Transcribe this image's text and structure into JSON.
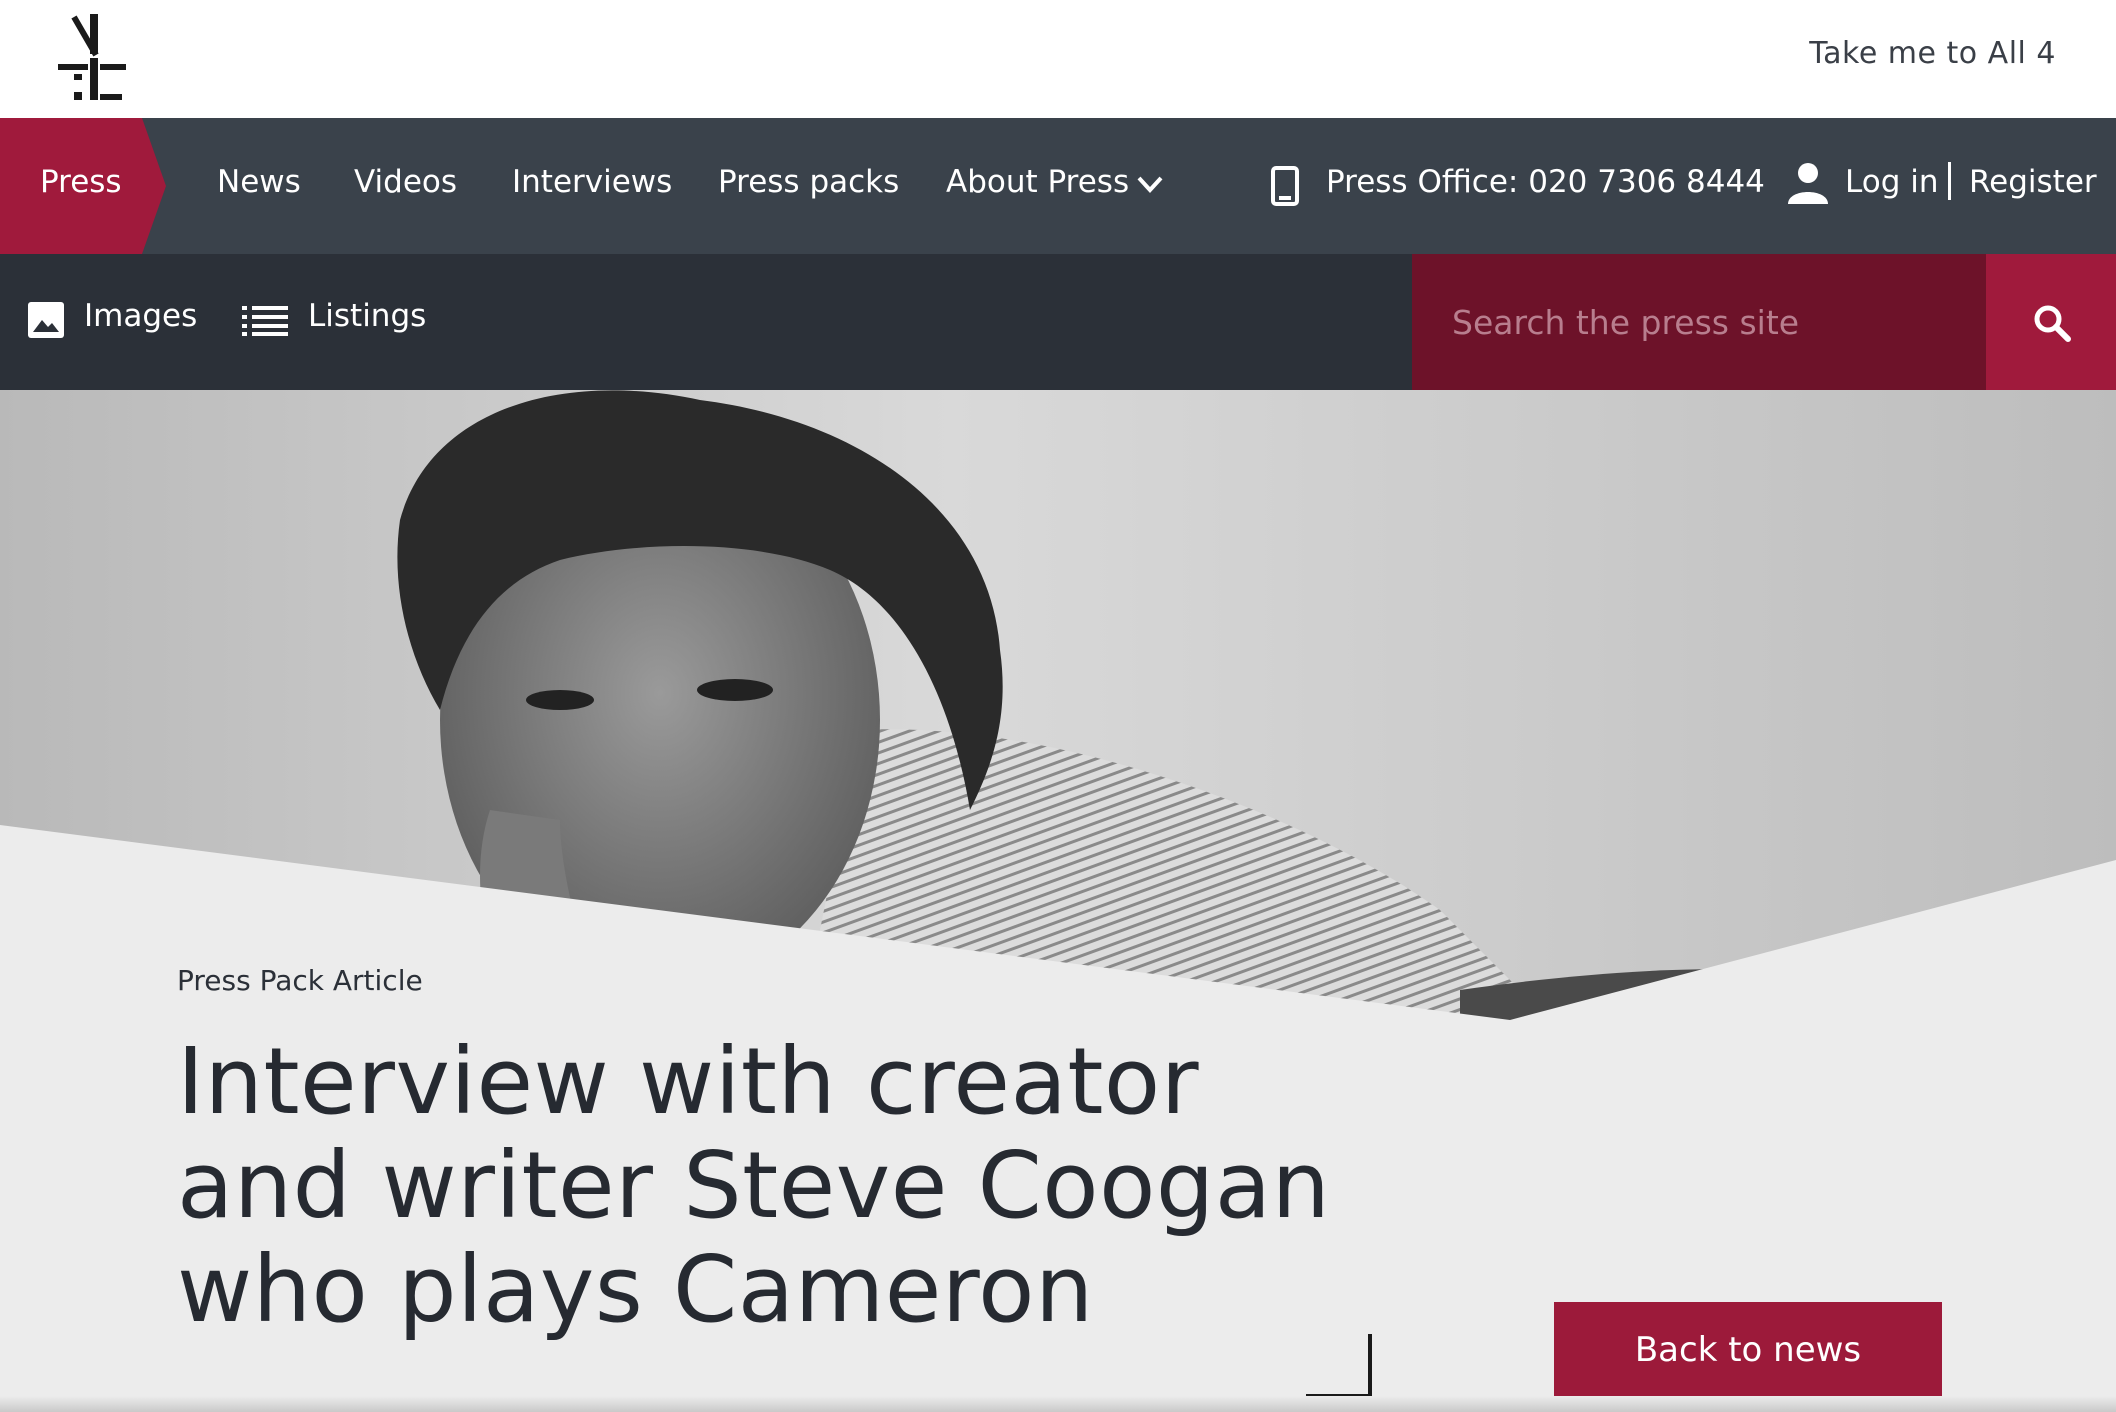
{
  "header": {
    "logo_icon": "channel-4-logo-icon",
    "all4_link": "Take me to All 4"
  },
  "nav": {
    "press": "Press",
    "items": [
      "News",
      "Videos",
      "Interviews",
      "Press packs",
      "About Press"
    ],
    "phone": "Press Office: 020 7306 8444",
    "login": "Log in",
    "register": "Register"
  },
  "subnav": {
    "images": "Images",
    "listings": "Listings",
    "search_placeholder": "Search the press site"
  },
  "article": {
    "kicker": "Press Pack Article",
    "title_lines": [
      "Interview with creator",
      "and writer Steve Coogan",
      "who plays Cameron"
    ],
    "back_button": "Back to news"
  },
  "colors": {
    "brand_red": "#a01a3c",
    "search_red": "#6d1229",
    "nav_dark": "#3a424b",
    "subnav_dark": "#2b3038"
  }
}
